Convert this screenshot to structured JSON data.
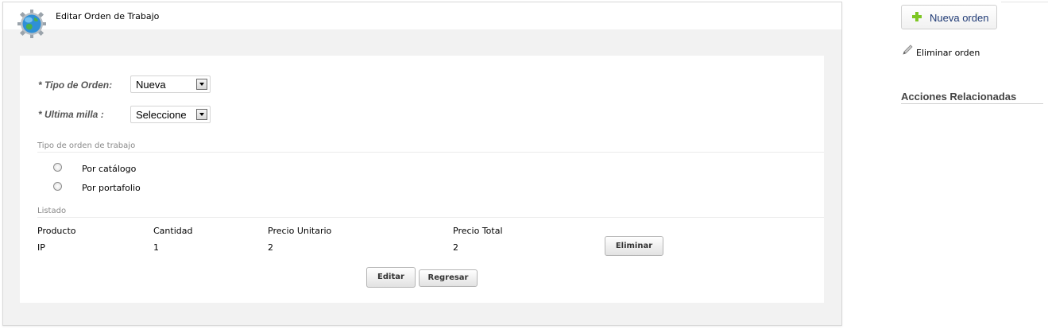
{
  "panel": {
    "title": "Editar Orden de Trabajo",
    "icon": "globe-gear-icon"
  },
  "form": {
    "tipo_orden_label": "* Tipo de Orden:",
    "tipo_orden_value": "Nueva",
    "ultima_milla_label": "* Ultima milla :",
    "ultima_milla_value": "Seleccione"
  },
  "tipo_trabajo": {
    "section_title": "Tipo de orden de trabajo",
    "options": [
      "Por catálogo",
      "Por portafolio"
    ]
  },
  "listado": {
    "section_title": "Listado",
    "columns": [
      "Producto",
      "Cantidad",
      "Precio Unitario",
      "Precio Total"
    ],
    "rows": [
      {
        "producto": "IP",
        "cantidad": "1",
        "precio_unitario": "2",
        "precio_total": "2",
        "action": "Eliminar"
      }
    ]
  },
  "actions": {
    "editar": "Editar",
    "regresar": "Regresar"
  },
  "sidebar": {
    "nueva_orden": "Nueva orden",
    "eliminar_orden": "Eliminar orden",
    "acciones_title": "Acciones Relacionadas"
  },
  "colors": {
    "panel_bg": "#f2f2f2",
    "accent_green": "#7dc623",
    "link_blue": "#1f3a75"
  }
}
